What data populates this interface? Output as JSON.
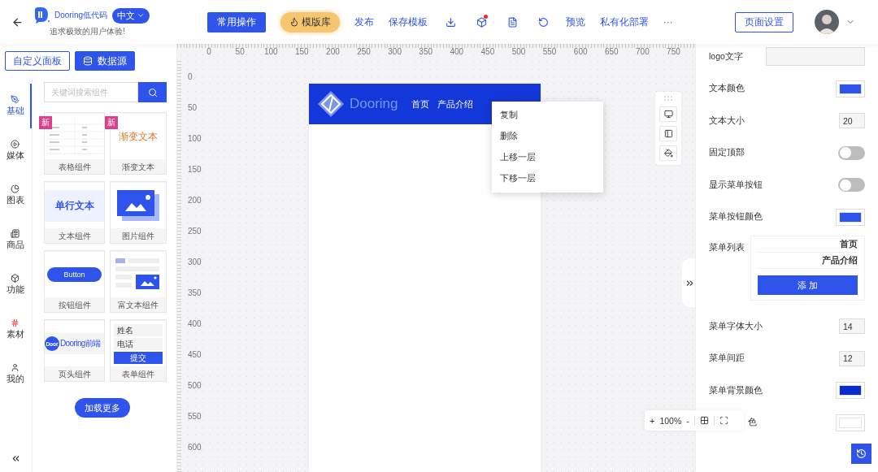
{
  "header": {
    "brand": "Dooring低代码",
    "language": "中文",
    "slogan": "追求极致的用户体验!",
    "actions": [
      {
        "kind": "primary",
        "label": "常用操作"
      },
      {
        "kind": "highlight",
        "label": "模版库"
      },
      {
        "kind": "link",
        "label": "发布"
      },
      {
        "kind": "link",
        "label": "保存模板"
      },
      {
        "kind": "icon",
        "dot": false
      },
      {
        "kind": "icon",
        "dot": true
      },
      {
        "kind": "icon",
        "dot": false
      },
      {
        "kind": "icon",
        "dot": false
      },
      {
        "kind": "link",
        "label": "预览"
      },
      {
        "kind": "link",
        "label": "私有化部署"
      },
      {
        "kind": "more",
        "label": "···"
      }
    ],
    "page_settings": "页面设置"
  },
  "panel_tabs": [
    {
      "label": "自定义面板",
      "selected": false
    },
    {
      "label": "数据源",
      "selected": true
    }
  ],
  "categories": [
    {
      "label": "基础",
      "selected": true
    },
    {
      "label": "媒体",
      "selected": false
    },
    {
      "label": "图表",
      "selected": false
    },
    {
      "label": "商品",
      "selected": false
    },
    {
      "label": "功能",
      "selected": false
    },
    {
      "label": "素材",
      "selected": false
    },
    {
      "label": "我的",
      "selected": false
    }
  ],
  "search": {
    "placeholder": "关键词搜索组件"
  },
  "components": [
    {
      "label": "表格组件",
      "kind": "table",
      "badge": "新"
    },
    {
      "label": "渐变文本",
      "kind": "gradient",
      "badge": "新",
      "texts": [
        "渐变文本"
      ]
    },
    {
      "label": "文本组件",
      "kind": "text",
      "texts": [
        "单行文本"
      ]
    },
    {
      "label": "图片组件",
      "kind": "image"
    },
    {
      "label": "按钮组件",
      "kind": "button",
      "texts": [
        "Button"
      ]
    },
    {
      "label": "富文本组件",
      "kind": "richtext"
    },
    {
      "label": "页头组件",
      "kind": "header",
      "texts": [
        "Door",
        "Dooring前端"
      ]
    },
    {
      "label": "表单组件",
      "kind": "form",
      "texts": [
        "姓名",
        "电话",
        "提交"
      ]
    }
  ],
  "load_more": "加载更多",
  "canvas": {
    "top_ruler": [
      "0",
      "50",
      "100",
      "150",
      "200",
      "250",
      "300",
      "350",
      "400",
      "450",
      "500",
      "550",
      "600",
      "650",
      "700",
      "750"
    ],
    "left_ruler": [
      "0",
      "50",
      "100",
      "150",
      "200",
      "250",
      "300",
      "350",
      "400",
      "450",
      "500",
      "550",
      "600"
    ],
    "page": {
      "logo": "Dooring",
      "nav": [
        "首页",
        "产品介绍"
      ]
    },
    "context_menu": [
      "复制",
      "删除",
      "上移一层",
      "下移一层"
    ],
    "zoom": {
      "plus": "+",
      "value": "100%",
      "minus": "-"
    }
  },
  "properties": [
    {
      "kind": "input",
      "label": "logo文字"
    },
    {
      "kind": "color",
      "label": "文本颜色",
      "color": "#2f54eb"
    },
    {
      "kind": "number",
      "label": "文本大小",
      "value": "20"
    },
    {
      "kind": "toggle",
      "label": "固定顶部",
      "on": false
    },
    {
      "kind": "toggle",
      "label": "显示菜单按钮",
      "on": false
    },
    {
      "kind": "color",
      "label": "菜单按钮颜色",
      "color": "#2f54eb"
    },
    {
      "kind": "list",
      "label": "菜单列表",
      "items": [
        "首页",
        "产品介绍"
      ],
      "button": "添 加"
    },
    {
      "kind": "number",
      "label": "菜单字体大小",
      "value": "14"
    },
    {
      "kind": "number",
      "label": "菜单间距",
      "value": "12"
    },
    {
      "kind": "color",
      "label": "菜单背景颜色",
      "color": "#0a2bd0"
    },
    {
      "kind": "color",
      "label": "色",
      "color": "#ffffff"
    }
  ]
}
